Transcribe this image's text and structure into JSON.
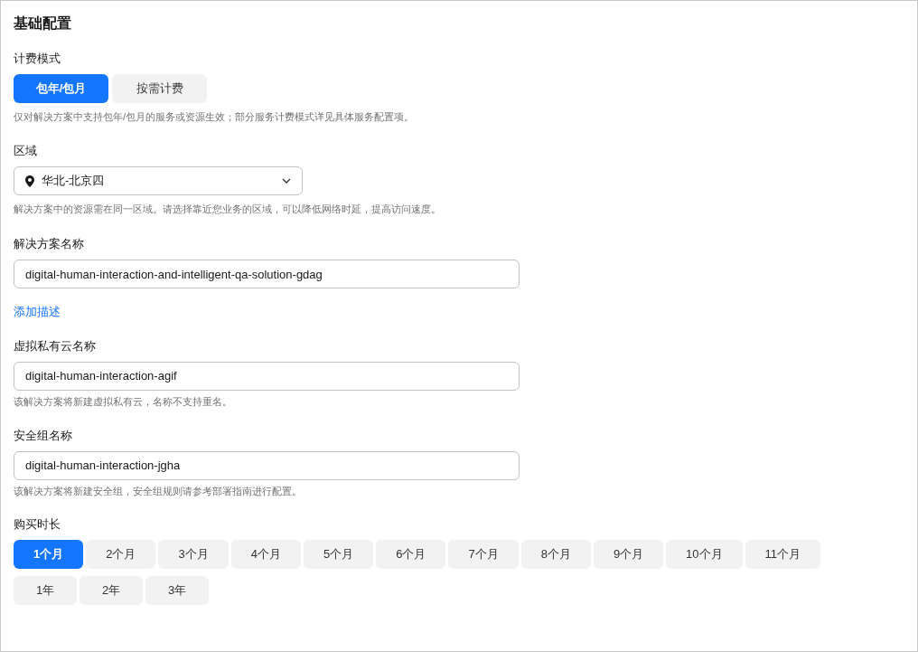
{
  "section_title": "基础配置",
  "billing": {
    "label": "计费模式",
    "options": [
      {
        "label": "包年/包月",
        "selected": true
      },
      {
        "label": "按需计费",
        "selected": false
      }
    ],
    "hint": "仅对解决方案中支持包年/包月的服务或资源生效；部分服务计费模式详见具体服务配置项。"
  },
  "region": {
    "label": "区域",
    "value": "华北-北京四",
    "hint": "解决方案中的资源需在同一区域。请选择靠近您业务的区域，可以降低网络时延，提高访问速度。"
  },
  "solution_name": {
    "label": "解决方案名称",
    "value": "digital-human-interaction-and-intelligent-qa-solution-gdag"
  },
  "add_description": "添加描述",
  "vpc_name": {
    "label": "虚拟私有云名称",
    "value": "digital-human-interaction-agif",
    "hint": "该解决方案将新建虚拟私有云，名称不支持重名。"
  },
  "security_group_name": {
    "label": "安全组名称",
    "value": "digital-human-interaction-jgha",
    "hint": "该解决方案将新建安全组，安全组规则请参考部署指南进行配置。"
  },
  "duration": {
    "label": "购买时长",
    "rows": [
      [
        {
          "label": "1个月",
          "selected": true
        },
        {
          "label": "2个月",
          "selected": false
        },
        {
          "label": "3个月",
          "selected": false
        },
        {
          "label": "4个月",
          "selected": false
        },
        {
          "label": "5个月",
          "selected": false
        },
        {
          "label": "6个月",
          "selected": false
        },
        {
          "label": "7个月",
          "selected": false
        },
        {
          "label": "8个月",
          "selected": false
        },
        {
          "label": "9个月",
          "selected": false
        },
        {
          "label": "10个月",
          "selected": false
        },
        {
          "label": "11个月",
          "selected": false
        }
      ],
      [
        {
          "label": "1年",
          "selected": false
        },
        {
          "label": "2年",
          "selected": false
        },
        {
          "label": "3年",
          "selected": false
        }
      ]
    ]
  }
}
